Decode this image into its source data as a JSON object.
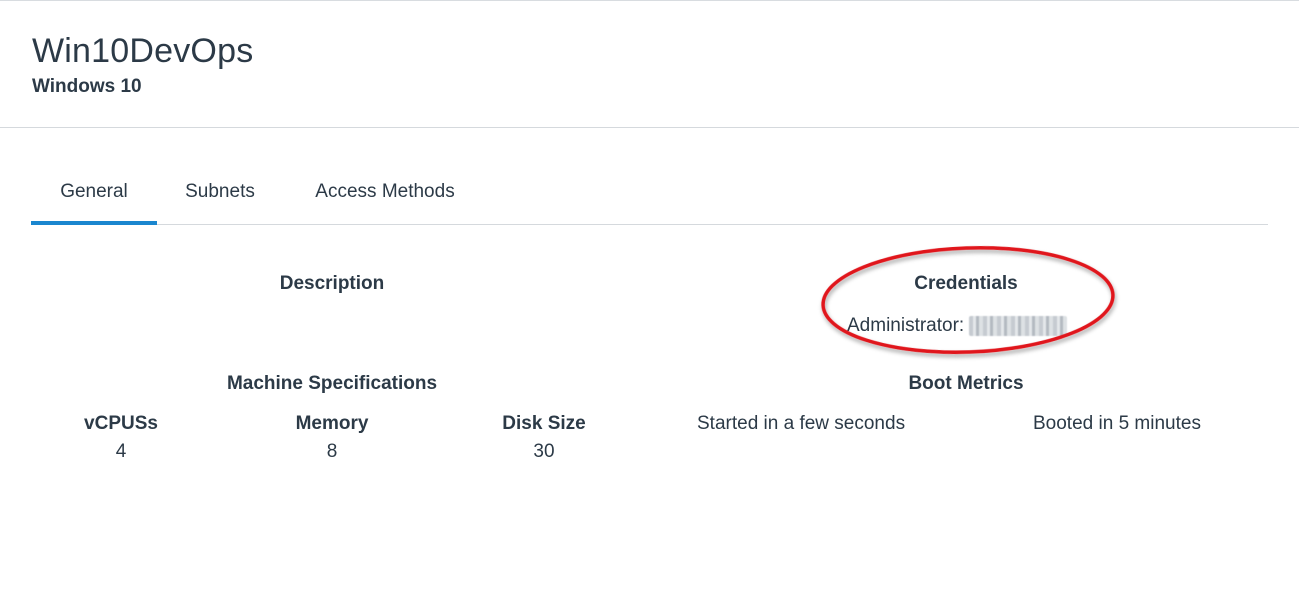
{
  "header": {
    "title": "Win10DevOps",
    "subtitle": "Windows 10"
  },
  "tabs": [
    {
      "label": "General",
      "active": true
    },
    {
      "label": "Subnets",
      "active": false
    },
    {
      "label": "Access Methods",
      "active": false
    }
  ],
  "description": {
    "heading": "Description"
  },
  "credentials": {
    "heading": "Credentials",
    "user_label": "Administrator:"
  },
  "machine_specs": {
    "heading": "Machine Specifications",
    "vcpus": {
      "label": "vCPUSs",
      "value": "4"
    },
    "memory": {
      "label": "Memory",
      "value": "8"
    },
    "disk": {
      "label": "Disk Size",
      "value": "30"
    }
  },
  "boot_metrics": {
    "heading": "Boot Metrics",
    "started": "Started in a few seconds",
    "booted": "Booted in 5 minutes"
  },
  "colors": {
    "accent": "#1a86cf",
    "annotation": "#e0141b",
    "text": "#2c3a47"
  }
}
